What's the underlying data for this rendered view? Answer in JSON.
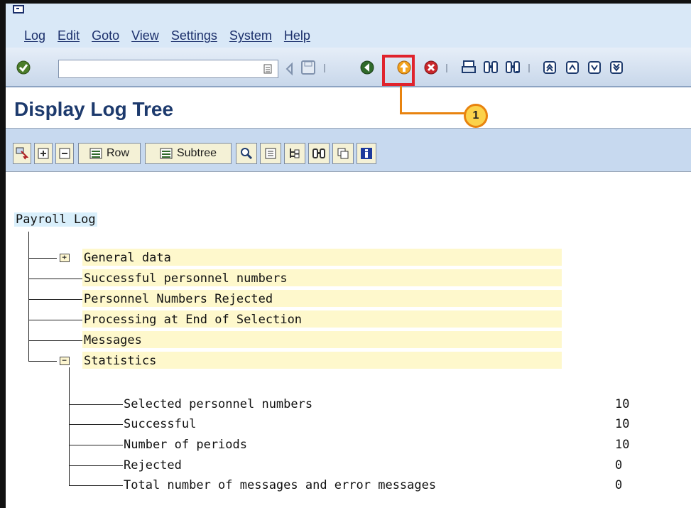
{
  "menu": {
    "items": [
      "Log",
      "Edit",
      "Goto",
      "View",
      "Settings",
      "System",
      "Help"
    ]
  },
  "toolbar": {
    "command_value": "",
    "icons": [
      "enter-icon",
      "save-icon",
      "back-icon",
      "exit-icon",
      "cancel-icon",
      "print-icon",
      "find-icon",
      "find-next-icon",
      "first-page-icon",
      "previous-page-icon",
      "next-page-icon",
      "last-page-icon"
    ],
    "accent_highlight": "#e0232d"
  },
  "title": "Display Log Tree",
  "callout": {
    "number": "1",
    "color": "#e8830f"
  },
  "app_toolbar": {
    "row_label": "Row",
    "subtree_label": "Subtree"
  },
  "tree": {
    "root": "Payroll Log",
    "level1": [
      "General data",
      "Successful personnel numbers",
      "Personnel Numbers Rejected",
      "Processing at End of Selection",
      "Messages",
      "Statistics"
    ],
    "statistics": [
      {
        "label": "Selected personnel numbers",
        "value": "10"
      },
      {
        "label": "Successful",
        "value": "10"
      },
      {
        "label": "Number of periods",
        "value": "10"
      },
      {
        "label": "Rejected",
        "value": "0"
      },
      {
        "label": "Total number of messages and error messages",
        "value": "0"
      }
    ]
  }
}
